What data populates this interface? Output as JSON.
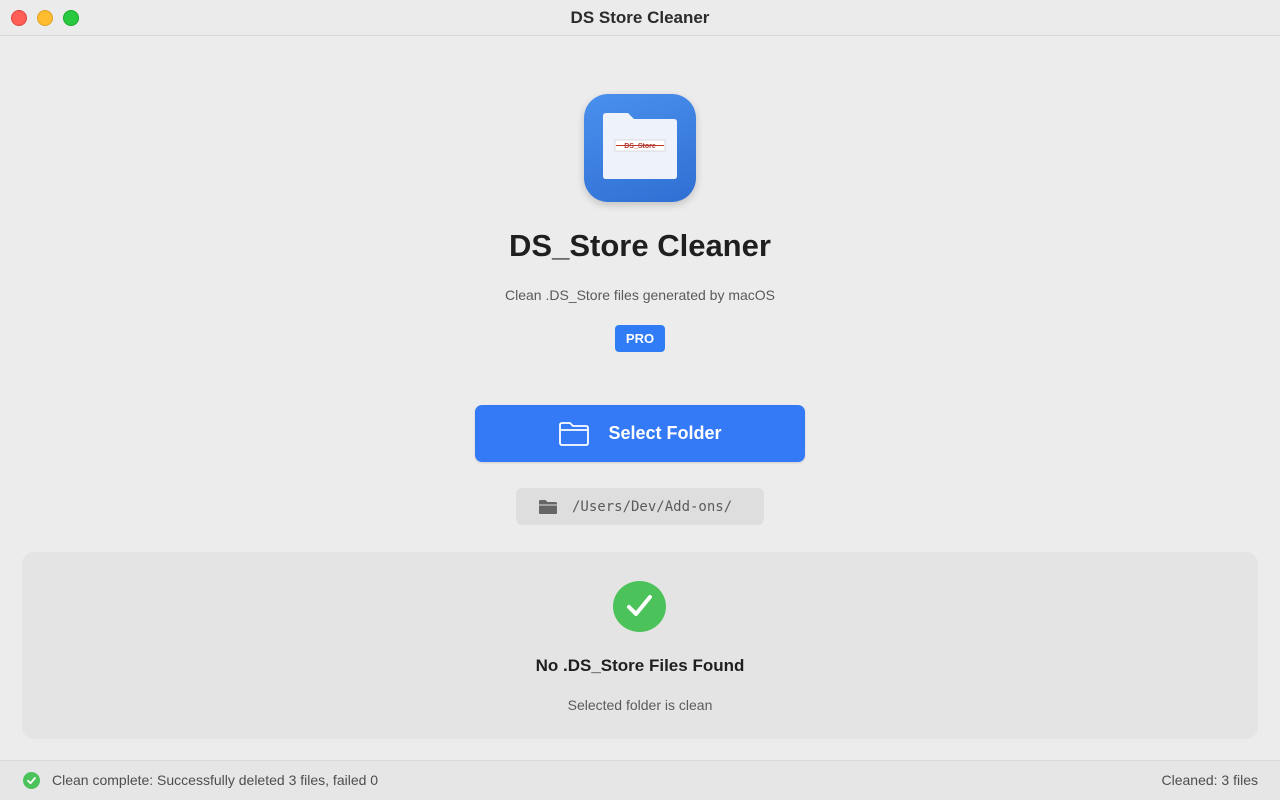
{
  "window": {
    "title": "DS Store Cleaner"
  },
  "app": {
    "icon_label": "DS_Store",
    "name": "DS_Store Cleaner",
    "subtitle": "Clean .DS_Store files generated by macOS",
    "badge": "PRO"
  },
  "actions": {
    "select_folder_label": "Select Folder",
    "selected_path": "/Users/Dev/Add-ons/"
  },
  "result": {
    "title": "No .DS_Store Files Found",
    "subtitle": "Selected folder is clean"
  },
  "status": {
    "message": "Clean complete: Successfully deleted 3 files, failed 0",
    "cleaned": "Cleaned: 3 files"
  },
  "colors": {
    "accent": "#3479f6",
    "success": "#4cc35a",
    "background": "#ececec"
  },
  "icons": {
    "app": "folder-icon",
    "button": "folder-outline-icon",
    "path": "folder-filled-icon",
    "result": "checkmark-circle-icon",
    "status": "checkmark-circle-small-icon"
  }
}
